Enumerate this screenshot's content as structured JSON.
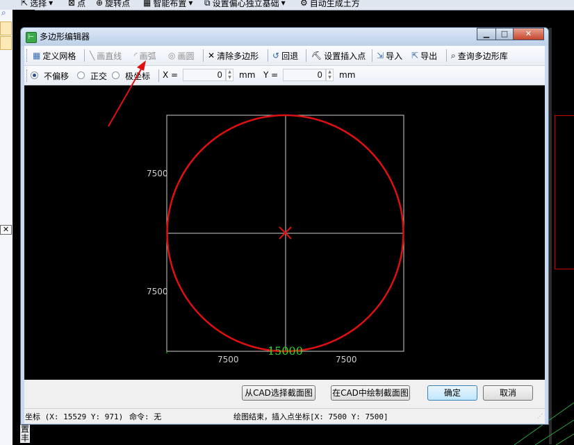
{
  "background_app": {
    "toolbar": {
      "select_label": "选择",
      "point_label": "点",
      "rotate_point_label": "旋转点",
      "smart_layout_label": "智能布置",
      "set_offset_label": "设置偏心独立基础",
      "auto_generate_label": "自动生成土方"
    },
    "side_text": "置\n丰"
  },
  "dialog": {
    "title": "多边形编辑器",
    "window_buttons": {
      "minimize": "▁",
      "maximize": "□",
      "close": "✕"
    },
    "toolbar": {
      "define_grid": "定义网格",
      "draw_line": "画直线",
      "draw_arc": "画弧",
      "draw_circle": "画圆",
      "clear_polygon": "清除多边形",
      "undo": "回退",
      "set_insert_point": "设置插入点",
      "import": "导入",
      "export": "导出",
      "query_library": "查询多边形库"
    },
    "options": {
      "no_offset": "不偏移",
      "orthogonal": "正交",
      "polar": "极坐标",
      "x_label": "X =",
      "x_value": "0",
      "x_unit": "mm",
      "y_label": "Y =",
      "y_value": "0",
      "y_unit": "mm",
      "selected_mode": "no_offset"
    },
    "canvas": {
      "left_dim_upper": "7500",
      "left_dim_lower": "7500",
      "bottom_dim_left": "7500",
      "bottom_dim_right": "7500",
      "bottom_total": "15000",
      "shape": "circle",
      "shape_color": "#e01010",
      "grid_color": "#cfcfcf",
      "total_color": "#22dd22"
    },
    "buttons": {
      "select_from_cad": "从CAD选择截面图",
      "draw_in_cad": "在CAD中绘制截面图",
      "ok": "确定",
      "cancel": "取消"
    },
    "status": {
      "coords": "坐标 (X: 15529 Y: 971)",
      "command": "命令: 无",
      "message": "绘图结束，插入点坐标[X: 7500 Y: 7500]"
    }
  },
  "annotation": {
    "arrow_color": "#e01010"
  }
}
